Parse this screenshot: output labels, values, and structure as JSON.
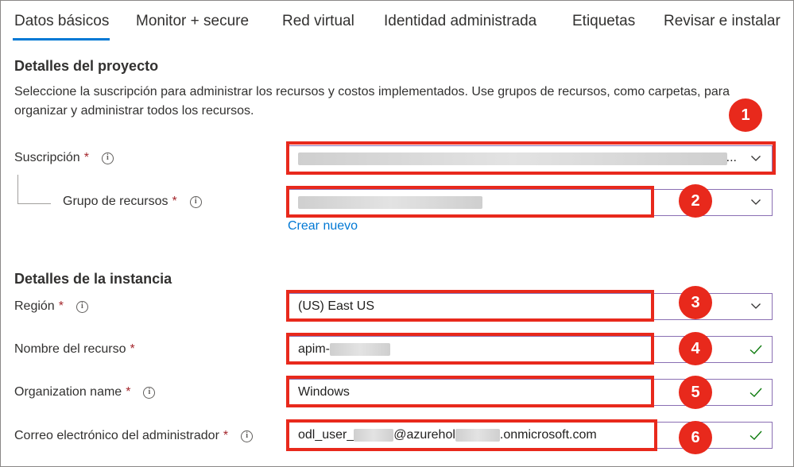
{
  "tabs": [
    "Datos básicos",
    "Monitor + secure",
    "Red virtual",
    "Identidad administrada",
    "Etiquetas",
    "Revisar e instalar"
  ],
  "project": {
    "title": "Detalles del proyecto",
    "description": "Seleccione la suscripción para administrar los recursos y costos implementados. Use grupos de recursos, como carpetas, para organizar y administrar todos los recursos.",
    "subscription_label": "Suscripción",
    "subscription_ellipsis": "...",
    "resource_group_label": "Grupo de recursos",
    "create_new": "Crear nuevo"
  },
  "instance": {
    "title": "Detalles de la instancia",
    "region_label": "Región",
    "region_value": "(US) East US",
    "resource_name_label": "Nombre del recurso",
    "resource_name_prefix": "apim-",
    "org_label": "Organization name",
    "org_value": "Windows",
    "email_label": "Correo electrónico del administrador",
    "email_part1": "odl_user_",
    "email_part2": "@azurehol",
    "email_part3": ".onmicrosoft.com"
  },
  "required_mark": "*",
  "info_glyph": "i",
  "badges": [
    "1",
    "2",
    "3",
    "4",
    "5",
    "6"
  ],
  "colors": {
    "accent": "#0078d4",
    "highlight": "#e8291c",
    "valid": "#107c10",
    "field_border": "#8a6fb3"
  }
}
